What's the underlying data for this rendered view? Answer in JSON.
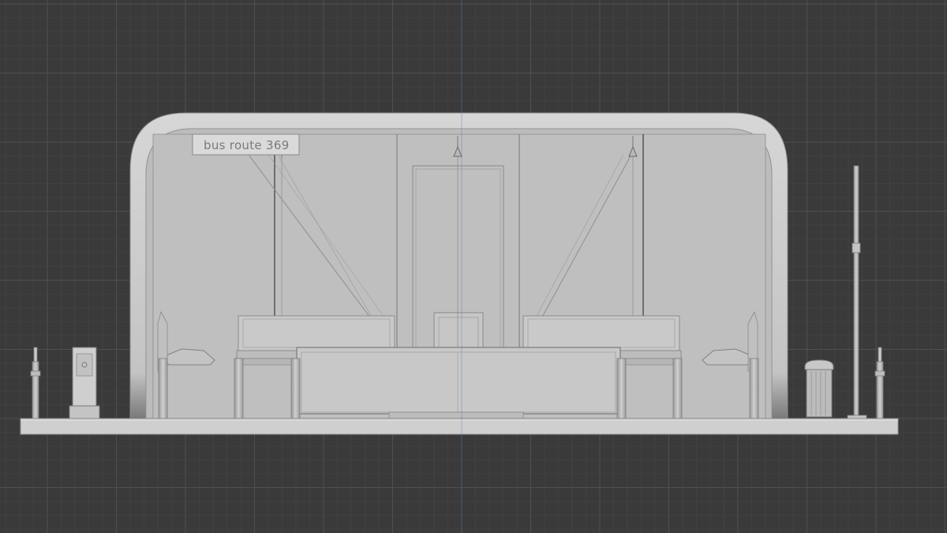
{
  "viewport": {
    "background_color": "#3a3a3a",
    "grid_minor_color": "#474747",
    "grid_major_color": "#505050",
    "model_color": "#c8c8c8",
    "model_edge_color": "#8c8c8c",
    "glass_color": "#bdbdbd"
  },
  "scene": {
    "route_sign": {
      "text": "bus route 369"
    },
    "objects": [
      "bus-shelter-canopy",
      "route-sign",
      "glass-panel",
      "pendant-lamp",
      "bench",
      "information-totem",
      "bollard",
      "waste-bin",
      "street-pole",
      "ground-slab"
    ]
  }
}
